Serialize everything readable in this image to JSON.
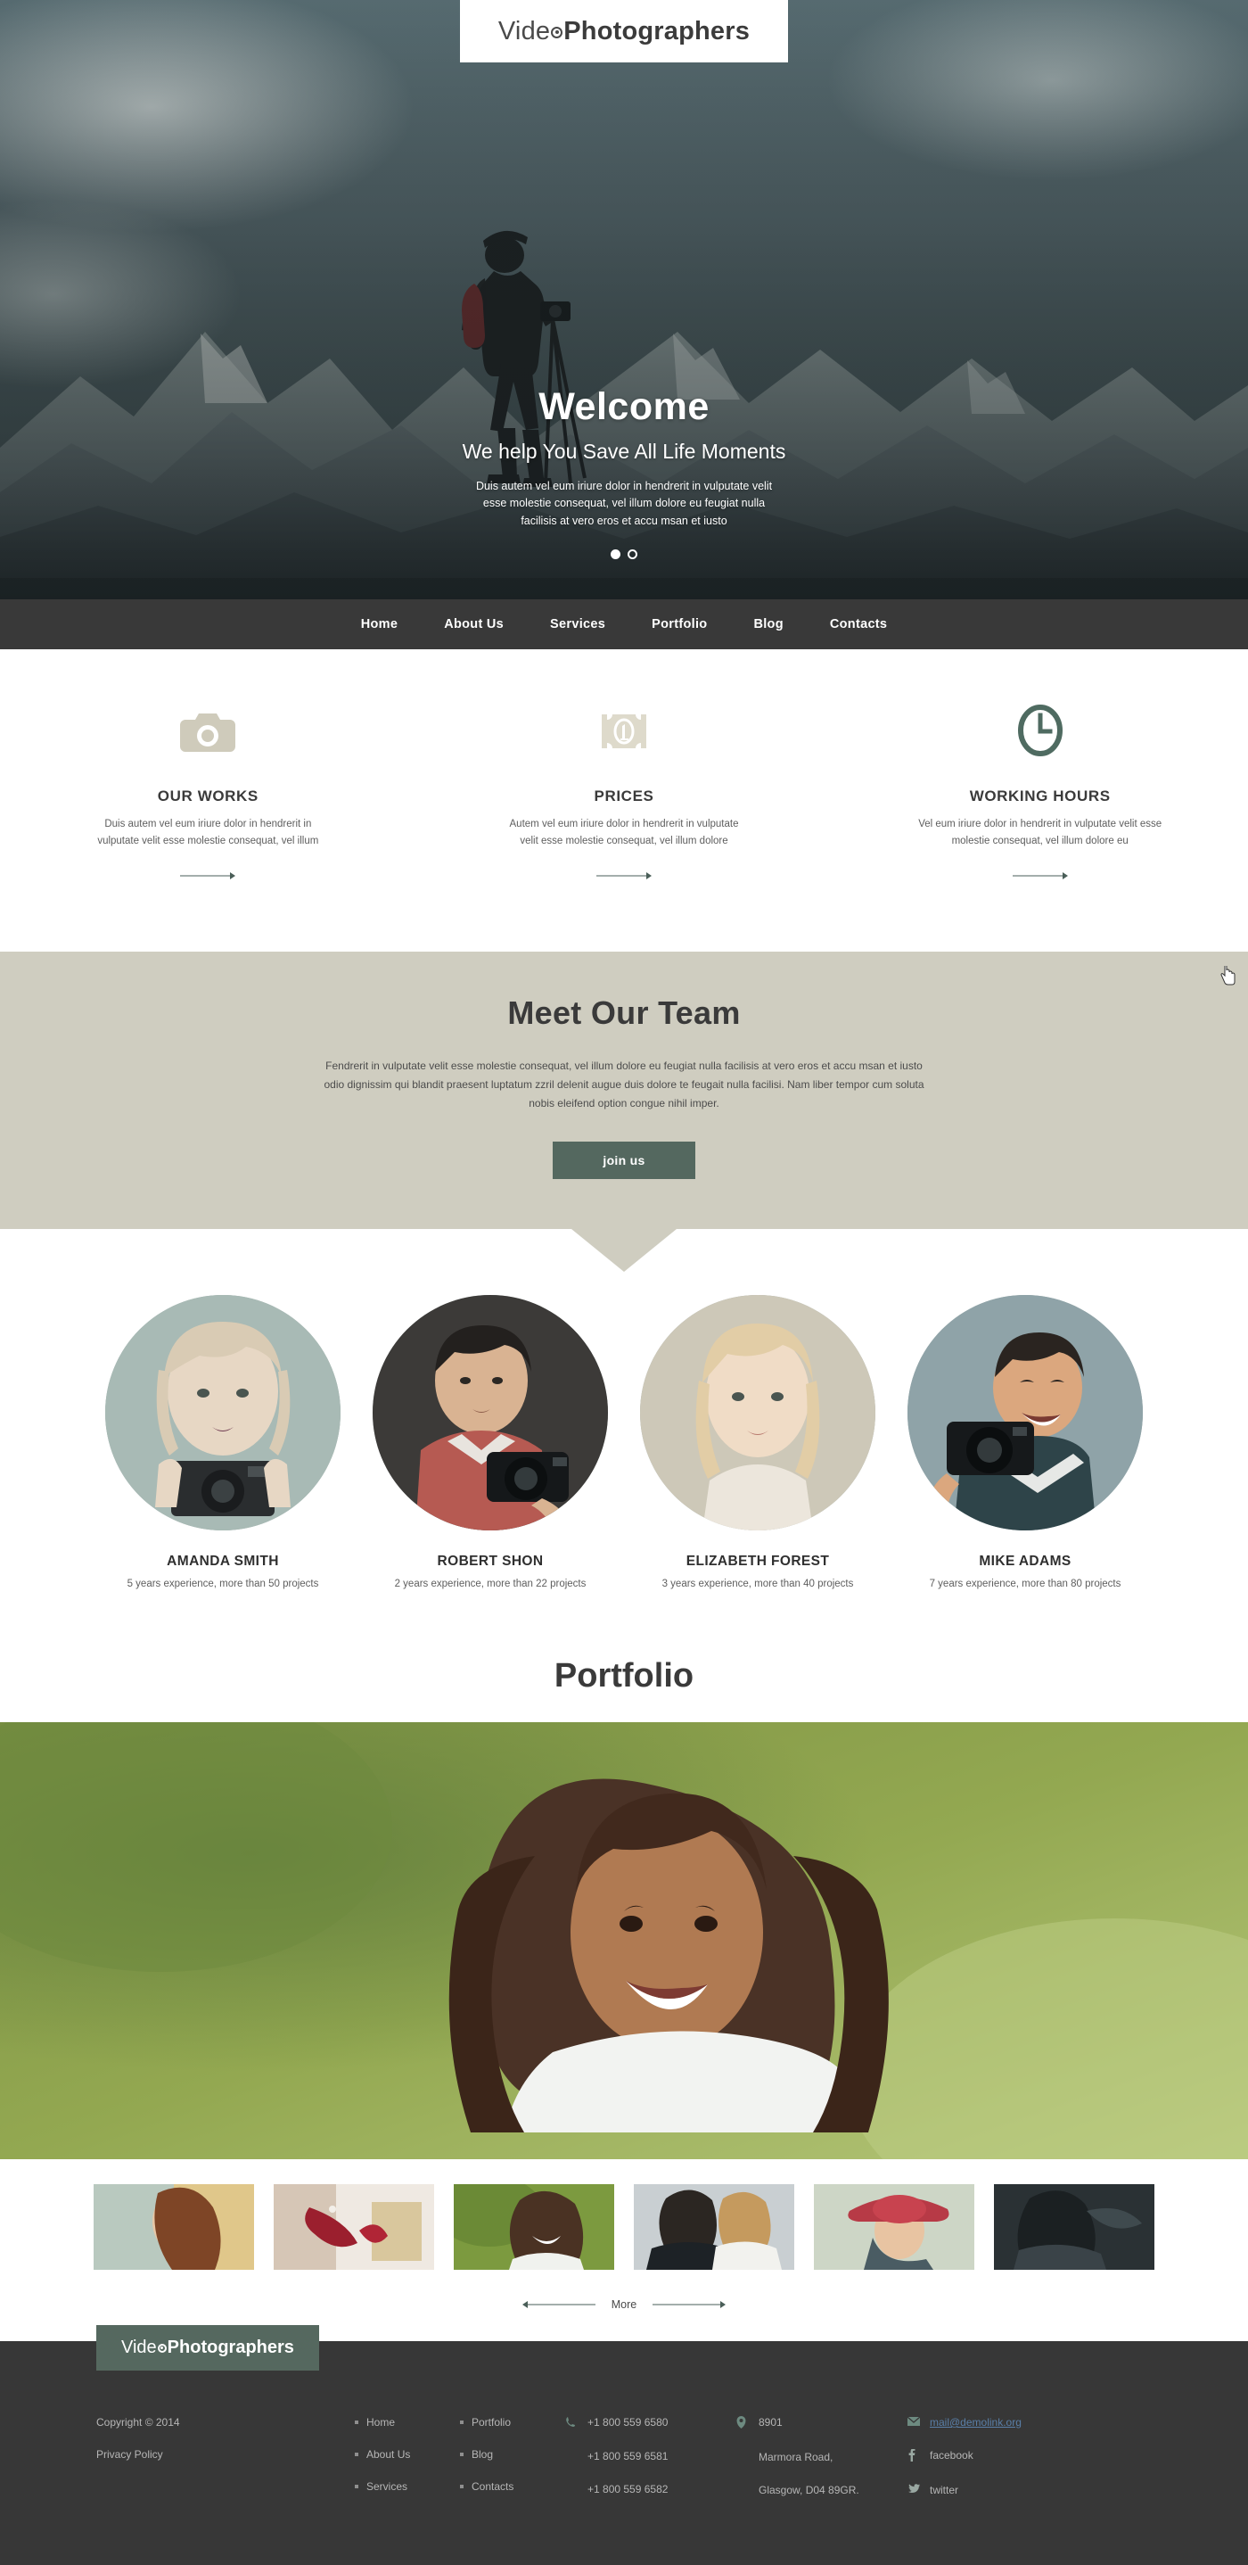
{
  "brand": {
    "light": "Vide",
    "bold": "Photographers"
  },
  "hero": {
    "title": "Welcome",
    "subtitle": "We help You Save All Life Moments",
    "description": "Duis autem vel eum iriure dolor in hendrerit in vulputate velit esse molestie consequat, vel illum dolore eu feugiat nulla facilisis at vero eros et accu msan et iusto",
    "slides": 2,
    "active_slide": 1
  },
  "nav": {
    "items": [
      {
        "label": "Home"
      },
      {
        "label": "About Us"
      },
      {
        "label": "Services"
      },
      {
        "label": "Portfolio"
      },
      {
        "label": "Blog"
      },
      {
        "label": "Contacts"
      }
    ]
  },
  "features": [
    {
      "icon": "camera-icon",
      "title": "OUR WORKS",
      "text": "Duis autem vel eum iriure dolor in hendrerit in vulputate velit esse molestie consequat, vel illum",
      "color": "#cfcbbb"
    },
    {
      "icon": "money-icon",
      "title": "PRICES",
      "text": "Autem vel eum iriure dolor in hendrerit in vulputate velit esse molestie consequat, vel illum dolore",
      "color": "#dedacb"
    },
    {
      "icon": "clock-icon",
      "title": "WORKING HOURS",
      "text": "Vel eum iriure dolor in hendrerit in vulputate velit esse molestie consequat, vel illum dolore eu",
      "color": "#4f6b61"
    }
  ],
  "team_cta": {
    "title": "Meet Our Team",
    "description": "Fendrerit in vulputate velit esse molestie consequat, vel illum dolore eu feugiat nulla facilisis at vero eros et accu msan et iusto odio dignissim qui blandit praesent luptatum zzril delenit augue duis dolore te feugait nulla facilisi. Nam liber tempor cum soluta nobis eleifend option congue nihil imper.",
    "button_label": "join us",
    "button_color": "#54685f",
    "bg_color": "#cfcdc0"
  },
  "team": [
    {
      "name": "AMANDA SMITH",
      "role": "5 years experience, more than 50 projects"
    },
    {
      "name": "ROBERT SHON",
      "role": "2 years experience, more than 22 projects"
    },
    {
      "name": "ELIZABETH FOREST",
      "role": "3 years experience, more than 40 projects"
    },
    {
      "name": "MIKE ADAMS",
      "role": "7 years experience, more than 80 projects"
    }
  ],
  "portfolio": {
    "title": "Portfolio",
    "more_label": "More",
    "thumbnails": [
      {
        "alt": "woman-profile-thumb"
      },
      {
        "alt": "bride-ribbon-thumb"
      },
      {
        "alt": "girl-outdoors-thumb"
      },
      {
        "alt": "couple-thumb"
      },
      {
        "alt": "red-hat-woman-thumb"
      },
      {
        "alt": "portrait-dark-thumb"
      }
    ]
  },
  "footer": {
    "copyright": "Copyright © 2014",
    "privacy": "Privacy Policy",
    "nav_col1": [
      "Home",
      "About Us",
      "Services"
    ],
    "nav_col2": [
      "Portfolio",
      "Blog",
      "Contacts"
    ],
    "phones": [
      "+1 800 559 6580",
      "+1 800 559 6581",
      "+1 800 559 6582"
    ],
    "address": [
      "8901",
      "Marmora Road,",
      "Glasgow, D04 89GR."
    ],
    "email": "mail@demolink.org",
    "social": [
      "facebook",
      "twitter"
    ],
    "logo_bg": "#55685f",
    "bg": "#373737"
  }
}
